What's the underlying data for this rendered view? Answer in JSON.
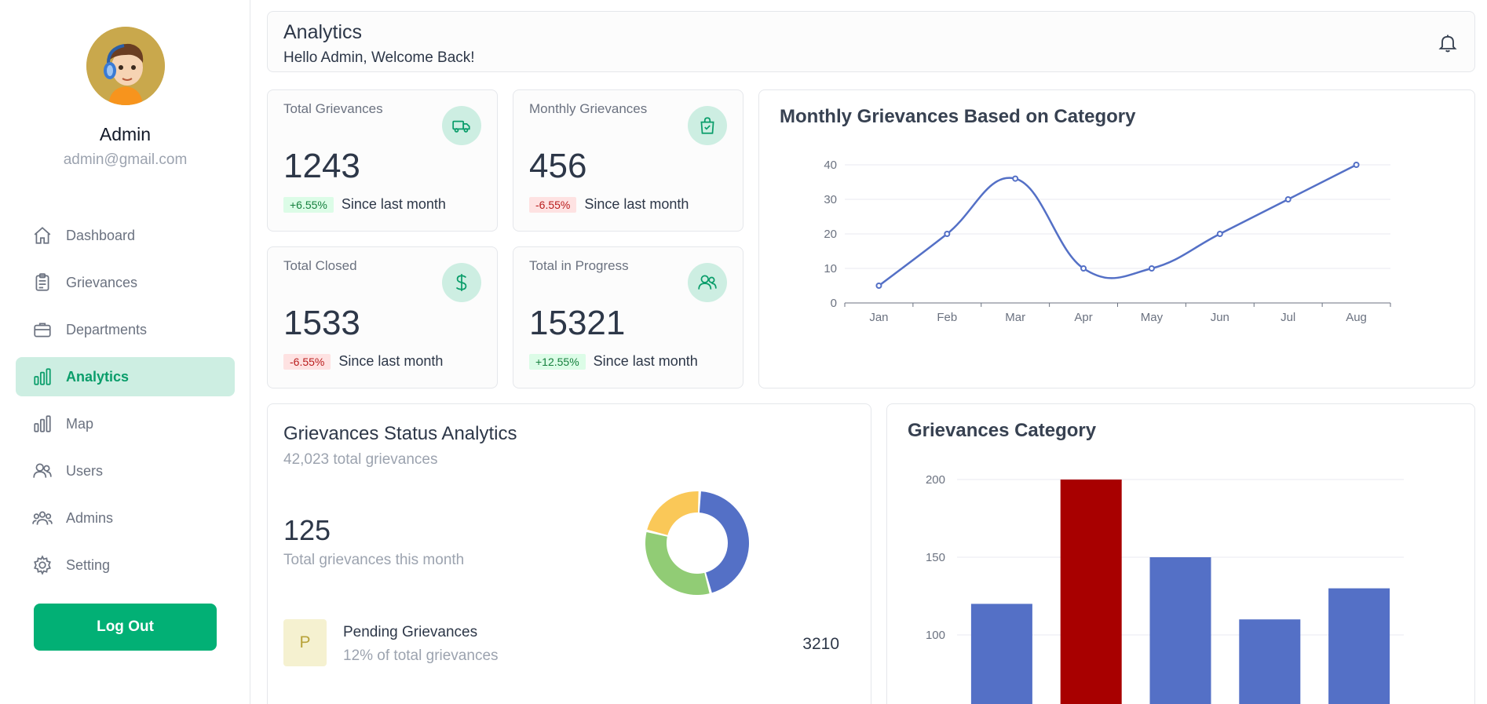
{
  "sidebar": {
    "admin_name": "Admin",
    "admin_email": "admin@gmail.com",
    "nav": [
      {
        "label": "Dashboard",
        "icon": "home-icon",
        "active": false
      },
      {
        "label": "Grievances",
        "icon": "clipboard-icon",
        "active": false
      },
      {
        "label": "Departments",
        "icon": "briefcase-icon",
        "active": false
      },
      {
        "label": "Analytics",
        "icon": "bar-chart-icon",
        "active": true
      },
      {
        "label": "Map",
        "icon": "bar-chart-icon",
        "active": false
      },
      {
        "label": "Users",
        "icon": "users-icon",
        "active": false
      },
      {
        "label": "Admins",
        "icon": "group-icon",
        "active": false
      },
      {
        "label": "Setting",
        "icon": "gear-icon",
        "active": false
      }
    ],
    "logout_label": "Log Out"
  },
  "header": {
    "title": "Analytics",
    "subtitle": "Hello Admin, Welcome Back!"
  },
  "stats": [
    {
      "title": "Total Grievances",
      "value": "1243",
      "change": "+6.55%",
      "trend": "up",
      "note": "Since last month",
      "icon": "truck-icon"
    },
    {
      "title": "Monthly Grievances",
      "value": "456",
      "change": "-6.55%",
      "trend": "down",
      "note": "Since last month",
      "icon": "bag-check-icon"
    },
    {
      "title": "Total Closed",
      "value": "1533",
      "change": "-6.55%",
      "trend": "down",
      "note": "Since last month",
      "icon": "dollar-icon"
    },
    {
      "title": "Total in Progress",
      "value": "15321",
      "change": "+12.55%",
      "trend": "up",
      "note": "Since last month",
      "icon": "users-icon"
    }
  ],
  "status_panel": {
    "title": "Grievances Status Analytics",
    "subtitle": "42,023 total grievances",
    "month_count": "125",
    "month_label": "Total grievances this month",
    "pending_letter": "P",
    "pending_title": "Pending Grievances",
    "pending_sub": "12% of total grievances",
    "pending_value": "3210"
  },
  "colors": {
    "accent": "#02b075",
    "accent_light": "#cdeee2",
    "series_blue": "#5470c6",
    "highlight_red": "#a80000",
    "donut_yellow": "#fac858",
    "donut_green": "#91cc75"
  },
  "chart_data": [
    {
      "type": "line",
      "title": "Monthly Grievances Based on Category",
      "categories": [
        "Jan",
        "Feb",
        "Mar",
        "Apr",
        "May",
        "Jun",
        "Jul",
        "Aug"
      ],
      "values": [
        5,
        20,
        36,
        10,
        10,
        20,
        30,
        40
      ],
      "ylim": [
        0,
        40
      ],
      "yticks": [
        0,
        10,
        20,
        30,
        40
      ],
      "grid": true,
      "smooth": true
    },
    {
      "type": "pie",
      "donut": true,
      "values": [
        45,
        33,
        22
      ],
      "colors": [
        "#5470c6",
        "#91cc75",
        "#fac858"
      ]
    },
    {
      "type": "bar",
      "title": "Grievances Category",
      "values": [
        120,
        200,
        150,
        110,
        130
      ],
      "colors": [
        "#5470c6",
        "#a80000",
        "#5470c6",
        "#5470c6",
        "#5470c6"
      ],
      "yticks": [
        100,
        150,
        200
      ],
      "grid": true
    }
  ]
}
